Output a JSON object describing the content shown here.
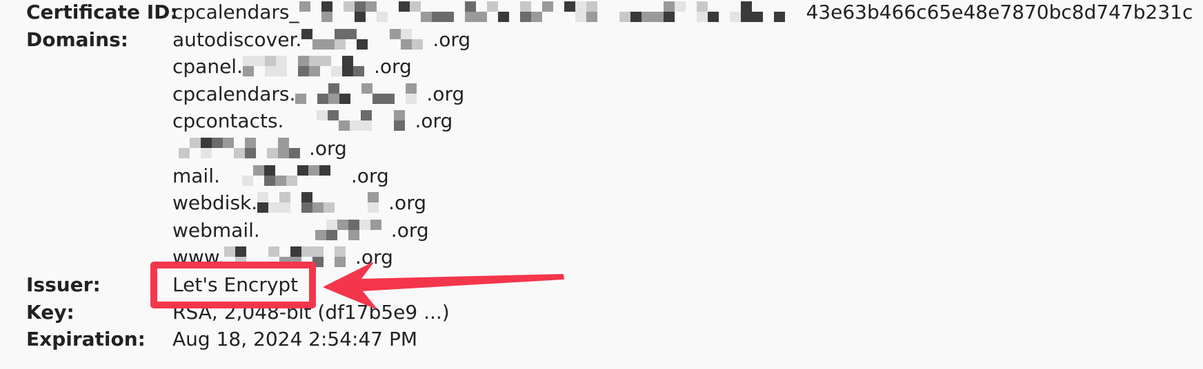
{
  "certificate": {
    "id_label": "Certificate ID:",
    "id_prefix": "cpcalendars_",
    "id_suffix": "43e63b466c65e48e7870bc8d747b231c",
    "domains_label": "Domains:",
    "domains": [
      {
        "prefix": "autodiscover.",
        "suffix": ".org"
      },
      {
        "prefix": "cpanel.",
        "suffix": ".org"
      },
      {
        "prefix": "cpcalendars.",
        "suffix": ".org"
      },
      {
        "prefix": "cpcontacts.",
        "suffix": ".org"
      },
      {
        "prefix": "",
        "suffix": ".org"
      },
      {
        "prefix": "mail.",
        "suffix": ".org"
      },
      {
        "prefix": "webdisk.",
        "suffix": ".org"
      },
      {
        "prefix": "webmail.",
        "suffix": ".org"
      },
      {
        "prefix": "www.",
        "suffix": ".org"
      }
    ],
    "issuer_label": "Issuer:",
    "issuer": "Let's Encrypt",
    "key_label": "Key:",
    "key": "RSA, 2,048-bit (df17b5e9 ...)",
    "expiration_label": "Expiration:",
    "expiration": "Aug 18, 2024 2:54:47 PM"
  },
  "annotation": {
    "color": "#f4364c",
    "arrow_icon": "arrow-left-icon"
  },
  "redaction": {
    "note_colors": [
      "#3a3a3a",
      "#6b6b6b",
      "#9a9a9a",
      "#c8c8c8",
      "#e4e4e4"
    ]
  }
}
